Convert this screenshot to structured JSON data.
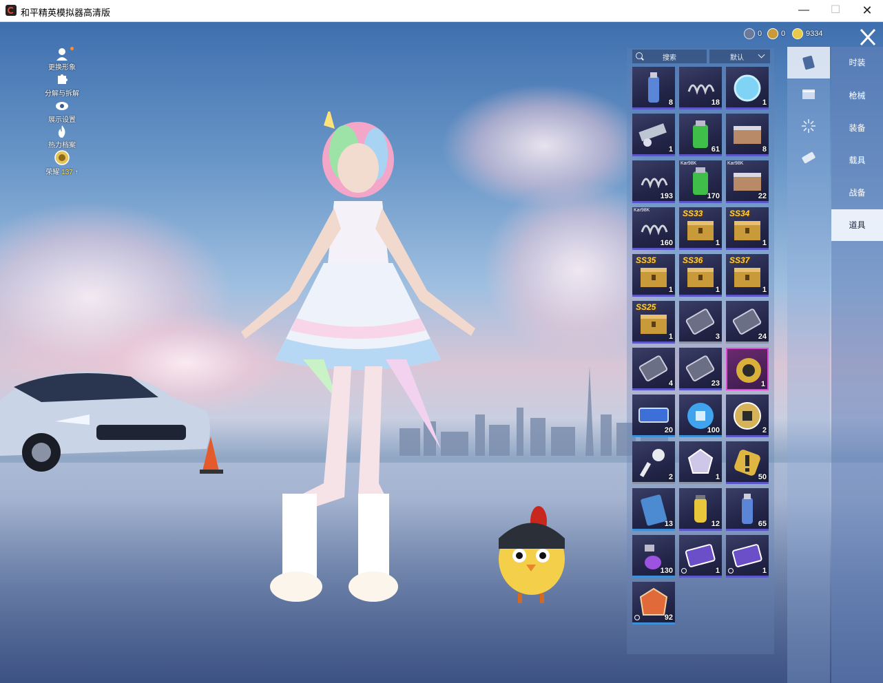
{
  "window": {
    "title": "和平精英模拟器高清版",
    "minimize": "—",
    "maximize": "☐",
    "close": "✕"
  },
  "left_menu": [
    {
      "label": "更换形象",
      "icon": "avatar-icon"
    },
    {
      "label": "分解与拆解",
      "icon": "puzzle-icon"
    },
    {
      "label": "展示设置",
      "icon": "eye-icon"
    },
    {
      "label": "热力档案",
      "icon": "flame-icon"
    },
    {
      "label": "荣耀",
      "icon": "rank-badge-icon",
      "value": "137"
    }
  ],
  "currency": [
    {
      "name": "coupon",
      "value": "0",
      "color": "#6c7a99"
    },
    {
      "name": "gold-coupon",
      "value": "0",
      "color": "#c89a3a"
    },
    {
      "name": "coin",
      "value": "9334",
      "color": "#e8c94a"
    }
  ],
  "inventory": {
    "search_placeholder": "搜索",
    "sort_label": "默认",
    "rows": [
      [
        {
          "icon": "spray-can-icon",
          "qty": "8",
          "rarity": "purple"
        },
        {
          "icon": "spring-icon",
          "qty": "18",
          "rarity": "purple"
        },
        {
          "icon": "frying-pan-icon",
          "qty": "1",
          "rarity": "purple"
        }
      ],
      [
        {
          "icon": "parts-icon",
          "qty": "1",
          "rarity": "purple"
        },
        {
          "icon": "paint-can-icon",
          "qty": "61",
          "rarity": "purple"
        },
        {
          "icon": "case-icon",
          "qty": "8",
          "rarity": "purple"
        }
      ],
      [
        {
          "icon": "spring-icon",
          "qty": "193",
          "rarity": "purple"
        },
        {
          "icon": "paint-can-icon",
          "qty": "170",
          "tag": "Kar98K",
          "rarity": "purple"
        },
        {
          "icon": "case-icon",
          "qty": "22",
          "tag": "Kar98K",
          "rarity": "purple"
        }
      ],
      [
        {
          "icon": "spring-icon",
          "qty": "160",
          "tag": "Kar98K",
          "rarity": "purple"
        },
        {
          "icon": "crate-icon",
          "qty": "1",
          "season": "SS33",
          "rarity": "purple"
        },
        {
          "icon": "crate-icon",
          "qty": "1",
          "season": "SS34",
          "rarity": "purple"
        }
      ],
      [
        {
          "icon": "crate-icon",
          "qty": "1",
          "season": "SS35",
          "rarity": "purple"
        },
        {
          "icon": "crate-icon",
          "qty": "1",
          "season": "SS36",
          "rarity": "purple"
        },
        {
          "icon": "crate-icon",
          "qty": "1",
          "season": "SS37",
          "rarity": "purple"
        }
      ],
      [
        {
          "icon": "crate-icon",
          "qty": "1",
          "season": "SS25",
          "rarity": "purple"
        },
        {
          "icon": "card-ticket-icon",
          "qty": "3",
          "rarity": "gray"
        },
        {
          "icon": "card-ticket-icon",
          "qty": "24",
          "rarity": "gray"
        }
      ],
      [
        {
          "icon": "card-ticket-icon",
          "qty": "4",
          "rarity": "purple"
        },
        {
          "icon": "card-ticket-icon",
          "qty": "23",
          "rarity": "purple"
        },
        {
          "icon": "renew-icon",
          "qty": "1",
          "rarity": "pink"
        }
      ],
      [
        {
          "icon": "ticket-icon",
          "qty": "20",
          "rarity": "blue"
        },
        {
          "icon": "puzzle-orb-icon",
          "qty": "100",
          "rarity": "blue"
        },
        {
          "icon": "puzzle-badge-icon",
          "qty": "2",
          "rarity": "purple"
        }
      ],
      [
        {
          "icon": "key-icon",
          "qty": "2",
          "rarity": "gray"
        },
        {
          "icon": "gem-icon",
          "qty": "1",
          "rarity": "gray"
        },
        {
          "icon": "alert-badge-icon",
          "qty": "50",
          "rarity": "purple"
        }
      ],
      [
        {
          "icon": "card-icon",
          "qty": "13",
          "rarity": "blue"
        },
        {
          "icon": "grenade-icon",
          "qty": "12",
          "rarity": "purple"
        },
        {
          "icon": "spray-can-icon",
          "qty": "65",
          "rarity": "purple"
        }
      ],
      [
        {
          "icon": "spray-gun-icon",
          "qty": "130",
          "rarity": "blue"
        },
        {
          "icon": "voucher-icon",
          "qty": "1",
          "rarity": "purple",
          "timed": true
        },
        {
          "icon": "voucher-icon",
          "qty": "1",
          "rarity": "purple",
          "timed": true
        }
      ],
      [
        {
          "icon": "emblem-icon",
          "qty": "92",
          "rarity": "blue",
          "timed": true
        }
      ]
    ]
  },
  "categories": [
    {
      "icon": "card-category-icon",
      "active": true
    },
    {
      "icon": "chest-category-icon",
      "active": false
    },
    {
      "icon": "burst-category-icon",
      "active": false
    },
    {
      "icon": "ticket-category-icon",
      "active": false
    }
  ],
  "tabs": [
    {
      "label": "时装",
      "active": false
    },
    {
      "label": "枪械",
      "active": false
    },
    {
      "label": "装备",
      "active": false
    },
    {
      "label": "载具",
      "active": false
    },
    {
      "label": "战备",
      "active": false
    },
    {
      "label": "道具",
      "active": true
    }
  ]
}
